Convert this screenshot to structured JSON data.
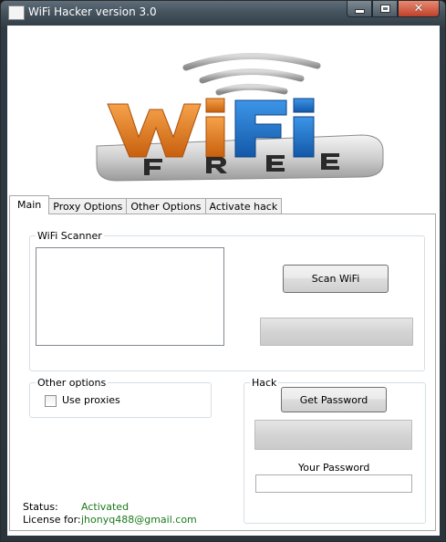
{
  "window": {
    "title": "WiFi  Hacker version 3.0",
    "caption_buttons": [
      "minimize-icon",
      "maximize-icon",
      "close-icon"
    ]
  },
  "banner": {
    "logo_word": "WiFi",
    "logo_sub": "FREE",
    "colors": {
      "orange": "#e07a1f",
      "blue": "#1d6fc9",
      "gray": "#b8b8b8",
      "dark": "#2a2a2a"
    }
  },
  "tabs": [
    {
      "label": "Main",
      "active": true
    },
    {
      "label": "Proxy Options",
      "active": false
    },
    {
      "label": "Other Options",
      "active": false
    },
    {
      "label": "Activate hack",
      "active": false
    }
  ],
  "scanner": {
    "group_label": "WiFi Scanner",
    "scan_button": "Scan WiFi",
    "progress_value": 0
  },
  "other_options": {
    "group_label": "Other options",
    "use_proxies_label": "Use proxies",
    "use_proxies_checked": false
  },
  "hack": {
    "group_label": "Hack",
    "get_password_button": "Get Password",
    "progress_value": 0,
    "your_password_label": "Your Password",
    "password_value": ""
  },
  "status": {
    "status_label": "Status:",
    "status_value": "Activated",
    "license_label": "License for:",
    "license_value": "jhonyq488@gmail.com"
  }
}
